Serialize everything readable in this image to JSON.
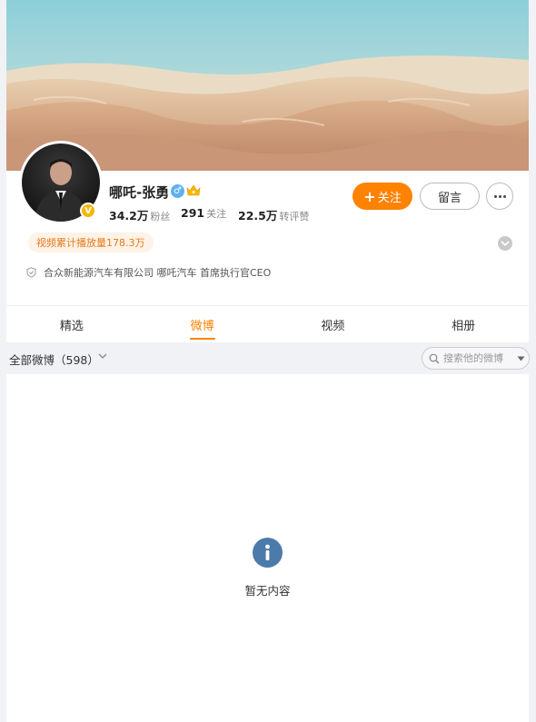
{
  "profile": {
    "name": "哪吒-张勇",
    "verified_mark": "V",
    "gender_symbol": "♂",
    "play_tag": "视频累计播放量178.3万",
    "company": "合众新能源汽车有限公司 哪吒汽车 首席执行官CEO",
    "stats": [
      {
        "value": "34.2万",
        "label": "粉丝"
      },
      {
        "value": "291",
        "label": "关注"
      },
      {
        "value": "22.5万",
        "label": "转评赞"
      }
    ]
  },
  "actions": {
    "follow_label": "关注",
    "message_label": "留言"
  },
  "tabs": [
    {
      "label": "精选",
      "active": false
    },
    {
      "label": "微博",
      "active": true
    },
    {
      "label": "视频",
      "active": false
    },
    {
      "label": "相册",
      "active": false
    }
  ],
  "filter": {
    "label": "全部微博（598）",
    "search_placeholder": "搜索他的微博"
  },
  "empty": {
    "text": "暂无内容"
  },
  "colors": {
    "accent": "#ff8200",
    "empty_icon": "#4c7bab",
    "verified": "#f7b500"
  }
}
